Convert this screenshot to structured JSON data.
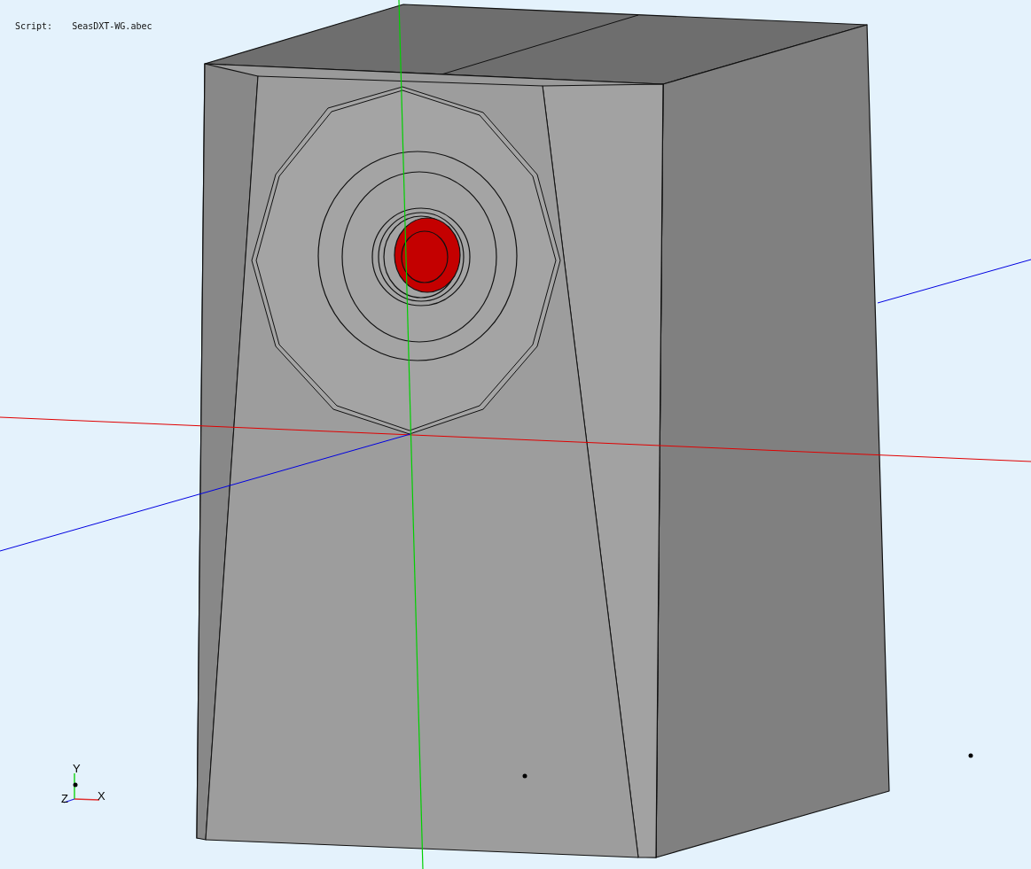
{
  "script": {
    "label": "Script:",
    "value": "SeasDXT-WG.abec"
  },
  "axis_gizmo": {
    "labels": [
      {
        "kind": "y",
        "text": "Y"
      },
      {
        "kind": "z",
        "text": "Z"
      },
      {
        "kind": "x",
        "text": "X"
      }
    ]
  }
}
